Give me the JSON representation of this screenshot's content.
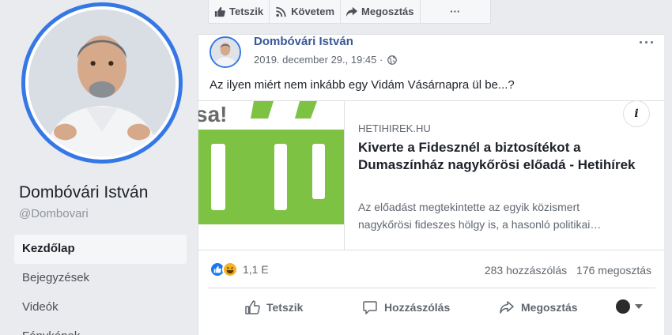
{
  "sidebar": {
    "page_name": "Dombóvári István",
    "handle": "@Dombovari",
    "nav": [
      {
        "label": "Kezdőlap",
        "active": true
      },
      {
        "label": "Bejegyzések",
        "active": false
      },
      {
        "label": "Videók",
        "active": false
      },
      {
        "label": "Fényképek",
        "active": false
      }
    ]
  },
  "actionbar": {
    "like": "Tetszik",
    "follow": "Követem",
    "share": "Megosztás",
    "more": "···"
  },
  "post": {
    "author": "Dombóvári István",
    "timestamp": "2019. december 29., 19:45 ·",
    "privacy_icon": "globe-icon",
    "text": "Az ilyen miért nem inkább egy Vidám Vásárnapra ül be...?",
    "more": "···",
    "link": {
      "domain": "HETIHIREK.HU",
      "title": "Kiverte a Fidesznél a biztosítékot a Dumaszínház nagykőrösi előadá - Hetihírek",
      "description_line1": "Az előadást megtekintette az egyik közismert",
      "description_line2": "nagykőrösi fideszes hölgy is, a hasonló politikai…",
      "info": "i"
    },
    "reactions": {
      "icons": [
        "like",
        "haha"
      ],
      "count": "1,1 E"
    },
    "comments": "283 hozzászólás",
    "shares": "176 megosztás",
    "actions": {
      "like": "Tetszik",
      "comment": "Hozzászólás",
      "share": "Megosztás"
    }
  },
  "colors": {
    "brand_blue": "#3578e5",
    "link_blue": "#385898",
    "preview_green": "#7dc242"
  }
}
